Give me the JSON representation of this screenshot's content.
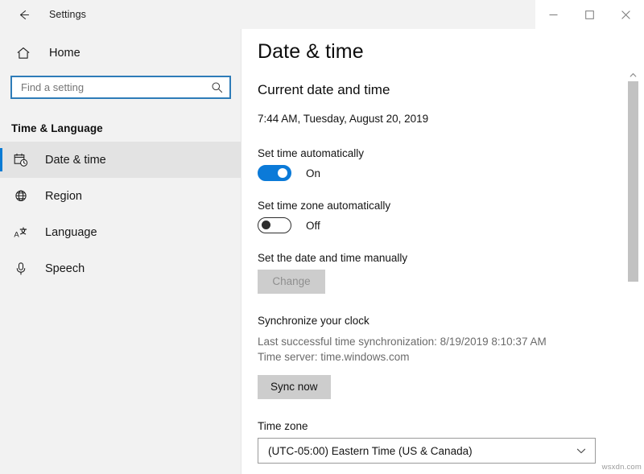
{
  "titlebar": {
    "back_icon": "back-arrow-icon",
    "app_title": "Settings",
    "minimize_icon": "minimize-icon",
    "maximize_icon": "maximize-icon",
    "close_icon": "close-icon"
  },
  "sidebar": {
    "home_label": "Home",
    "home_icon": "home-icon",
    "search": {
      "placeholder": "Find a setting",
      "value": "",
      "icon": "search-icon"
    },
    "category_heading": "Time & Language",
    "items": [
      {
        "label": "Date & time",
        "icon": "calendar-clock-icon",
        "selected": true
      },
      {
        "label": "Region",
        "icon": "globe-icon",
        "selected": false
      },
      {
        "label": "Language",
        "icon": "language-icon",
        "selected": false
      },
      {
        "label": "Speech",
        "icon": "microphone-icon",
        "selected": false
      }
    ]
  },
  "main": {
    "page_title": "Date & time",
    "current_section_heading": "Current date and time",
    "current_datetime": "7:44 AM, Tuesday, August 20, 2019",
    "set_time_auto": {
      "label": "Set time automatically",
      "state": "On",
      "on": true
    },
    "set_timezone_auto": {
      "label": "Set time zone automatically",
      "state": "Off",
      "on": false
    },
    "manual": {
      "label": "Set the date and time manually",
      "button_label": "Change",
      "button_disabled": true
    },
    "sync": {
      "heading": "Synchronize your clock",
      "last_sync": "Last successful time synchronization: 8/19/2019 8:10:37 AM",
      "time_server": "Time server: time.windows.com",
      "button_label": "Sync now"
    },
    "timezone": {
      "label": "Time zone",
      "value": "(UTC-05:00) Eastern Time (US & Canada)",
      "chevron_icon": "chevron-down-icon"
    }
  },
  "scrollbar": {
    "up_arrow_icon": "chevron-up-icon"
  },
  "watermark": "wsxdn.com",
  "colors": {
    "accent": "#0b7ad8",
    "sidebar_bg": "#f2f2f2",
    "selected_bar": "#0a7bd4",
    "search_border": "#2e7cb8",
    "button_bg": "#cdcdcd"
  }
}
